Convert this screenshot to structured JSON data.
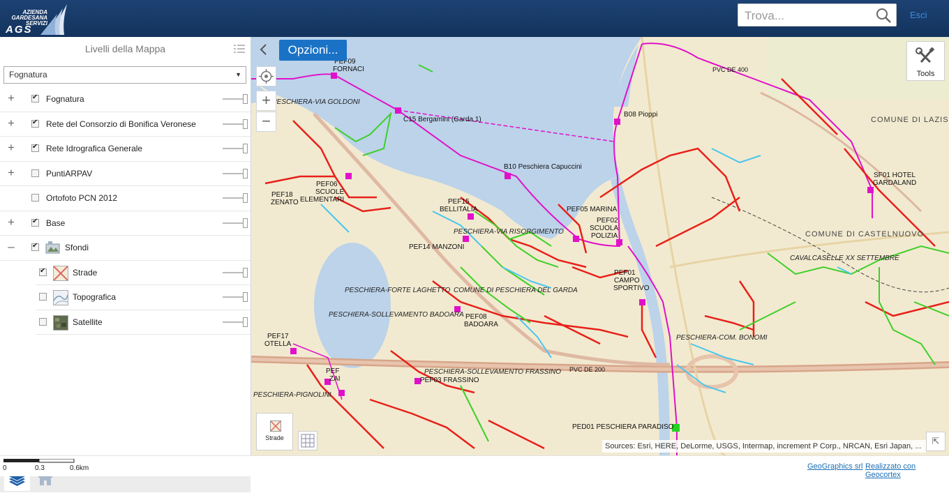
{
  "header": {
    "logo_line1": "AZIENDA",
    "logo_line2": "GARDESANA",
    "logo_line3": "SERVIZI",
    "logo_big": "AGS",
    "search_placeholder": "Trova...",
    "exit_label": "Esci"
  },
  "panel": {
    "title": "Livelli della Mappa",
    "dropdown_value": "Fognatura",
    "layers": [
      {
        "name": "Fognatura",
        "checked": true,
        "expandable": true
      },
      {
        "name": "Rete del Consorzio di Bonifica Veronese",
        "checked": true,
        "expandable": true
      },
      {
        "name": "Rete Idrografica Generale",
        "checked": true,
        "expandable": true
      },
      {
        "name": "PuntiARPAV",
        "checked": false,
        "expandable": true
      },
      {
        "name": "Ortofoto PCN 2012",
        "checked": false,
        "expandable": false
      },
      {
        "name": "Base",
        "checked": true,
        "expandable": true
      },
      {
        "name": "Sfondi",
        "checked": true,
        "expandable": "collapse"
      }
    ],
    "sublayers": [
      {
        "name": "Strade",
        "checked": true
      },
      {
        "name": "Topografica",
        "checked": false
      },
      {
        "name": "Satellite",
        "checked": false
      }
    ]
  },
  "map": {
    "options_label": "Opzioni...",
    "tools_label": "Tools",
    "basemap_label": "Strade",
    "attribution": "Sources: Esri, HERE, DeLorme, USGS, Intermap, increment P Corp., NRCAN, Esri Japan, ...",
    "labels": {
      "pef09": "PEF09",
      "fornaci": "FORNACI",
      "c15": "C15 Bergamini (Garda 1)",
      "b08": "B08 Pioppi",
      "b10": "B10 Peschiera Capuccini",
      "pef05": "PEF05 MARINA",
      "pef02": "PEF02",
      "scuola": "SCUOLA",
      "polizia": "POLIZIA",
      "pef15": "PEF15",
      "bellitalia": "BELLITALIA",
      "pef14": "PEF14 MANZONI",
      "pef01": "PEF01",
      "campo": "CAMPO",
      "sportivo": "SPORTIVO",
      "pef08": "PEF08",
      "badoara": "BADOARA",
      "pef17": "PEF17",
      "otella": "OTELLA",
      "pef18": "PEF18",
      "zenato": "ZENATO",
      "pef06": "PEF06",
      "scuole": "SCUOLE",
      "elementari": "ELEMENTARI",
      "pef03": "PEF03 FRASSINO",
      "pef_zai": "PEF",
      "zai": "ZAI",
      "ped01": "PED01 PESCHIERA PARADISO",
      "sf01": "SF01 HOTEL",
      "gardaland": "GARDALAND",
      "comune_lazise": "COMUNE DI LAZISE",
      "comune_castelnuovo": "COMUNE DI CASTELNUOVO",
      "cavalcaselle": "CAVALCASELLE XX SETTEMBRE",
      "via_risorgimento": "PESCHIERA-VIA RISORGIMENTO",
      "forte_laghetto": "PESCHIERA-FORTE LAGHETTO",
      "sollevamento_badoara": "PESCHIERA-SOLLEVAMENTO BADOARA",
      "sollevamento_frassino": "PESCHIERA-SOLLEVAMENTO FRASSINO",
      "pignolini": "PESCHIERA-PIGNOLINI",
      "via_goldoni": "PESCHIERA-VIA GOLDONI",
      "com_bonomi": "PESCHIERA-COM. BONOMI",
      "comune_di_peschiera": "COMUNE DI PESCHIERA DEL GARDA",
      "pvc_de_200": "PVC DE 200",
      "pvc_de_400": "PVC DE 400"
    }
  },
  "footer": {
    "scale_0": "0",
    "scale_1": "0.3",
    "scale_2": "0.6km",
    "link1": "GeoGraphics srl",
    "link2": "Realizzato con Geocortex"
  }
}
